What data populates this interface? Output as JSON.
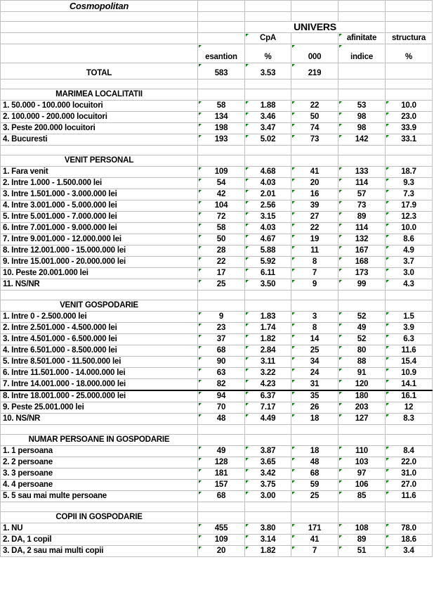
{
  "title": "Cosmopolitan",
  "header": {
    "univers": "UNIVERS",
    "cpa": "CpA",
    "afinitate": "afinitate",
    "structura": "structura",
    "esantion": "esantion",
    "percent": "%",
    "thousands": "000",
    "indice": "indice",
    "percent2": "%"
  },
  "total": {
    "label": "TOTAL",
    "esantion": "583",
    "cpa": "3.53",
    "univers": "219"
  },
  "sections": [
    {
      "title": "MARIMEA LOCALITATII",
      "rows": [
        [
          "1. 50.000 - 100.000 locuitori",
          "58",
          "1.88",
          "22",
          "53",
          "10.0"
        ],
        [
          "2. 100.000 - 200.000 locuitori",
          "134",
          "3.46",
          "50",
          "98",
          "23.0"
        ],
        [
          "3. Peste 200.000 locuitori",
          "198",
          "3.47",
          "74",
          "98",
          "33.9"
        ],
        [
          "4. Bucuresti",
          "193",
          "5.02",
          "73",
          "142",
          "33.1"
        ]
      ]
    },
    {
      "title": "VENIT PERSONAL",
      "rows": [
        [
          "1. Fara venit",
          "109",
          "4.68",
          "41",
          "133",
          "18.7"
        ],
        [
          "2. Intre 1.000 - 1.500.000 lei",
          "54",
          "4.03",
          "20",
          "114",
          "9.3"
        ],
        [
          "3. Intre 1.501.000 - 3.000.000 lei",
          "42",
          "2.01",
          "16",
          "57",
          "7.3"
        ],
        [
          "4. Intre 3.001.000 - 5.000.000 lei",
          "104",
          "2.56",
          "39",
          "73",
          "17.9"
        ],
        [
          "5. Intre 5.001.000 - 7.000.000 lei",
          "72",
          "3.15",
          "27",
          "89",
          "12.3"
        ],
        [
          "6. Intre 7.001.000 - 9.000.000 lei",
          "58",
          "4.03",
          "22",
          "114",
          "10.0"
        ],
        [
          "7. Intre 9.001.000 - 12.000.000 lei",
          "50",
          "4.67",
          "19",
          "132",
          "8.6"
        ],
        [
          "8. Intre 12.001.000 - 15.000.000 lei",
          "28",
          "5.88",
          "11",
          "167",
          "4.9"
        ],
        [
          "9. Intre 15.001.000 - 20.000.000 lei",
          "22",
          "5.92",
          "8",
          "168",
          "3.7"
        ],
        [
          "10. Peste 20.001.000 lei",
          "17",
          "6.11",
          "7",
          "173",
          "3.0"
        ],
        [
          "11. NS/NR",
          "25",
          "3.50",
          "9",
          "99",
          "4.3"
        ]
      ]
    },
    {
      "title": "VENIT GOSPODARIE",
      "rows": [
        [
          "1. Intre 0 - 2.500.000 lei",
          "9",
          "1.83",
          "3",
          "52",
          "1.5"
        ],
        [
          "2. Intre 2.501.000 - 4.500.000 lei",
          "23",
          "1.74",
          "8",
          "49",
          "3.9"
        ],
        [
          "3. Intre 4.501.000 - 6.500.000 lei",
          "37",
          "1.82",
          "14",
          "52",
          "6.3"
        ],
        [
          "4. Intre 6.501.000 - 8.500.000 lei",
          "68",
          "2.84",
          "25",
          "80",
          "11.6"
        ],
        [
          "5. Intre 8.501.000 - 11.500.000 lei",
          "90",
          "3.11",
          "34",
          "88",
          "15.4"
        ],
        [
          "6. Intre 11.501.000 - 14.000.000 lei",
          "63",
          "3.22",
          "24",
          "91",
          "10.9"
        ],
        [
          "7. Intre 14.001.000 - 18.000.000 lei",
          "82",
          "4.23",
          "31",
          "120",
          "14.1"
        ],
        [
          "8. Intre 18.001.000 - 25.000.000 lei",
          "94",
          "6.37",
          "35",
          "180",
          "16.1"
        ],
        [
          "9. Peste 25.001.000 lei",
          "70",
          "7.17",
          "26",
          "203",
          "12"
        ],
        [
          "10. NS/NR",
          "48",
          "4.49",
          "18",
          "127",
          "8.3"
        ]
      ]
    },
    {
      "title": "NUMAR PERSOANE IN GOSPODARIE",
      "rows": [
        [
          "1. 1 persoana",
          "49",
          "3.87",
          "18",
          "110",
          "8.4"
        ],
        [
          "2. 2 persoane",
          "128",
          "3.65",
          "48",
          "103",
          "22.0"
        ],
        [
          "3. 3 persoane",
          "181",
          "3.42",
          "68",
          "97",
          "31.0"
        ],
        [
          "4. 4 persoane",
          "157",
          "3.75",
          "59",
          "106",
          "27.0"
        ],
        [
          "5. 5 sau mai multe persoane",
          "68",
          "3.00",
          "25",
          "85",
          "11.6"
        ]
      ]
    },
    {
      "title": "COPII IN GOSPODARIE",
      "rows": [
        [
          "1. NU",
          "455",
          "3.80",
          "171",
          "108",
          "78.0"
        ],
        [
          "2. DA, 1 copil",
          "109",
          "3.14",
          "41",
          "89",
          "18.6"
        ],
        [
          "3. DA, 2 sau mai multi copii",
          "20",
          "1.82",
          "7",
          "51",
          "3.4"
        ]
      ]
    }
  ]
}
